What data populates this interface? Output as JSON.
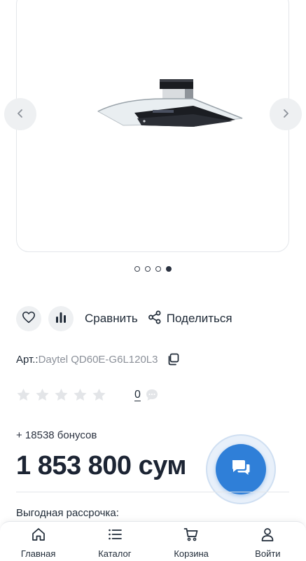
{
  "gallery": {
    "prev_icon": "chevron-left-icon",
    "next_icon": "chevron-right-icon",
    "image_alt": "Daytel hood",
    "slide_count": 4,
    "active_slide": 4
  },
  "actions": {
    "favorite_icon": "heart-icon",
    "compare_icon": "bar-chart-icon",
    "compare_label": "Сравнить",
    "share_icon": "share-icon",
    "share_label": "Поделиться"
  },
  "product": {
    "article_label": "Арт.:",
    "article_value": "Daytel QD60E-G6L120L3",
    "copy_icon": "copy-icon",
    "rating": 0,
    "max_rating": 5,
    "review_count": "0",
    "bonus": "+ 18538 бонусов",
    "price": "1 853 800 сум",
    "installment_label": "Выгодная рассрочка:"
  },
  "chat": {
    "icon": "chat-icon"
  },
  "bottom_nav": [
    {
      "label": "Главная",
      "icon": "home-icon"
    },
    {
      "label": "Каталог",
      "icon": "catalog-icon"
    },
    {
      "label": "Корзина",
      "icon": "cart-icon"
    },
    {
      "label": "Войти",
      "icon": "user-icon"
    }
  ],
  "colors": {
    "accent": "#2f7fd8",
    "text": "#1f2a37",
    "muted": "#8b9099",
    "star_empty": "#e3e5e8",
    "button_bg": "#eef0f2"
  }
}
